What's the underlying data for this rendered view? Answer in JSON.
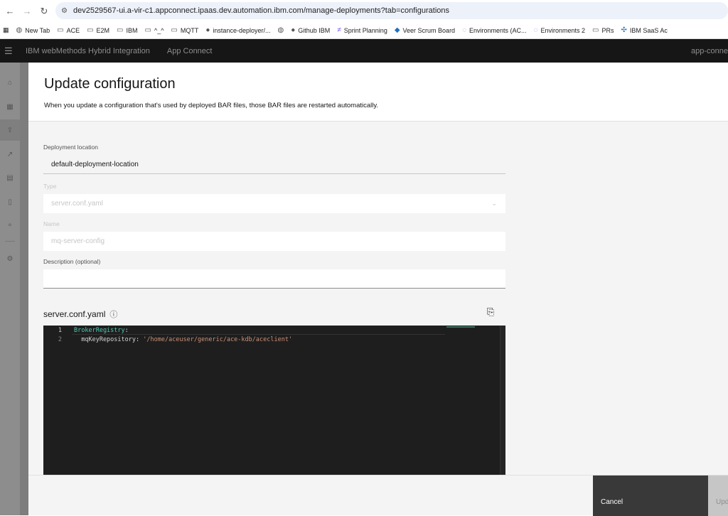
{
  "browser": {
    "url": "dev2529567-ui.a-vir-c1.appconnect.ipaas.dev.automation.ibm.com/manage-deployments?tab=configurations",
    "bookmarks": [
      "New Tab",
      "ACE",
      "E2M",
      "IBM",
      "^_^",
      "MQTT",
      "instance-deployer/...",
      "",
      "Github IBM",
      "Sprint Planning",
      "Veer Scrum Board",
      "Environments (AC...",
      "Environments 2",
      "PRs",
      "IBM SaaS Ac"
    ]
  },
  "header": {
    "brand": "IBM webMethods Hybrid Integration",
    "app": "App Connect",
    "right": "app-conne"
  },
  "panel": {
    "title": "Update configuration",
    "subtitle": "When you update a configuration that's used by deployed BAR files, those BAR files are restarted automatically."
  },
  "form": {
    "deployment_location": {
      "label": "Deployment location",
      "value": "default-deployment-location"
    },
    "type": {
      "label": "Type",
      "value": "server.conf.yaml"
    },
    "name": {
      "label": "Name",
      "value": "mq-server-config"
    },
    "description": {
      "label": "Description (optional)",
      "value": ""
    }
  },
  "editor": {
    "title": "server.conf.yaml",
    "lines": [
      {
        "num": "1",
        "key": "BrokerRegistry",
        "sep": ":"
      },
      {
        "num": "2",
        "key": "  mqKeyRepository",
        "sep": ": ",
        "value": "'/home/aceuser/generic/ace-kdb/aceclient'"
      }
    ]
  },
  "footer": {
    "cancel": "Cancel",
    "update": "Update"
  }
}
